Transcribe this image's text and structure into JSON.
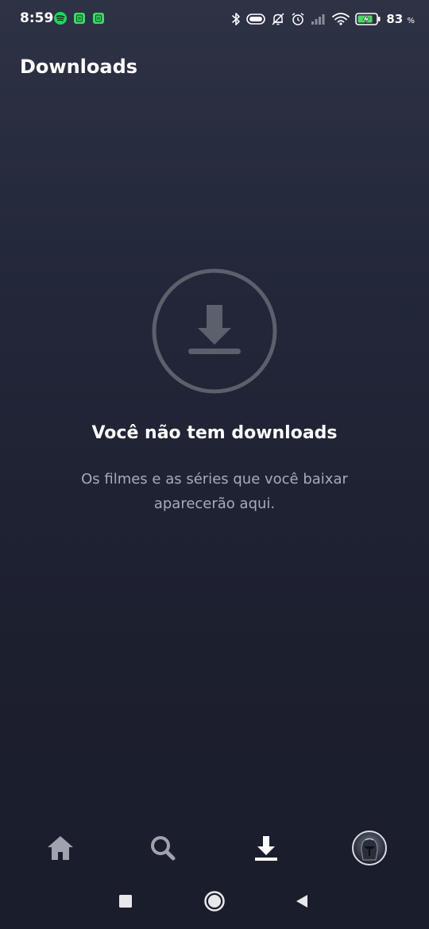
{
  "status_bar": {
    "time": "8:59",
    "battery_level": "83",
    "battery_unit": "%"
  },
  "page": {
    "title": "Downloads"
  },
  "empty_state": {
    "heading": "Você não tem downloads",
    "description": "Os filmes e as séries que você baixar aparecerão aqui."
  },
  "bottom_nav": {
    "items": [
      {
        "icon": "home-icon",
        "active": false
      },
      {
        "icon": "search-icon",
        "active": false
      },
      {
        "icon": "download-icon",
        "active": true
      },
      {
        "icon": "profile-avatar",
        "active": false
      }
    ]
  },
  "colors": {
    "background_top": "#2e3245",
    "background_bottom": "#1a1d2b",
    "inactive_icon": "#a0a2ad",
    "active_icon": "#ffffff",
    "spotify_green": "#1ed760",
    "app_green": "#3ddc6a",
    "battery_green": "#4cd964"
  }
}
